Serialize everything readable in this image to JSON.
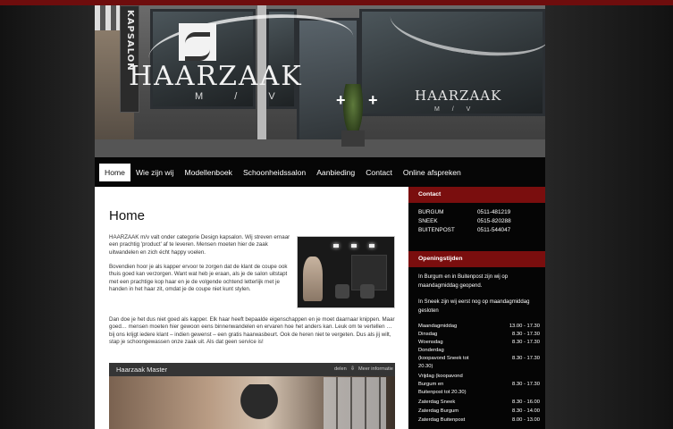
{
  "header": {
    "sign_text": "KAPSALON",
    "brand": "HAARZAAK",
    "brand_sub": "M / V",
    "window_brand": "HAARZAAK",
    "window_sub": "M / V"
  },
  "nav": {
    "items": [
      {
        "label": "Home",
        "active": true
      },
      {
        "label": "Wie zijn wij"
      },
      {
        "label": "Modellenboek"
      },
      {
        "label": "Schoonheidssalon"
      },
      {
        "label": "Aanbieding"
      },
      {
        "label": "Contact"
      },
      {
        "label": "Online afspreken"
      }
    ]
  },
  "main": {
    "title": "Home",
    "para1": "HAARZAAK m/v valt onder categorie Design kapsalon. Wij streven ernaar een prachtig 'product' af te leveren. Mensen moeten hier de zaak uitwandelen en zich écht happy voelen.",
    "para2": "Bovendien hoor je als kapper ervoor te zorgen dat de klant de coupe ook thuis goed kan verzorgen. Want wat heb je eraan, als je de salon uitstapt met een prachtige kop haar en je de volgende ochtend letterlijk met je handen in het haar zit, omdat je de coupe niet kunt stylen.",
    "para3": "Dan doe je het dus niet goed als kapper. Elk haar heeft bepaalde eigenschappen en je moet daarnaar knippen. Maar goed… mensen moeten hier gewoon eens binnenwandelen en ervaren hoe het anders kan. Leuk om te vertellen … bij ons krijgt iedere klant – indien gewenst – een gratis haarwasbeurt. Ook de heren niet te vergeten. Dus als jij wilt, stap je schoongewassen onze zaak uit. Als dat geen service is!",
    "video": {
      "title": "Haarzaak Master",
      "share_label": "delen",
      "info_label": "Meer informatie"
    }
  },
  "sidebar": {
    "contact_heading": "Contact",
    "contacts": [
      {
        "city": "BURGUM",
        "phone": "0511-481219"
      },
      {
        "city": "SNEEK",
        "phone": "0515-820288"
      },
      {
        "city": "BUITENPOST",
        "phone": "0511-544047"
      }
    ],
    "hours_heading": "Openingstijden",
    "note1": "In Burgum en in Buitenpost zijn wij op maandagmiddag geopend.",
    "note2": "In Sneek zijn wij eerst nog op maandagmiddag gesloten",
    "hours": [
      {
        "day": "Maandagmiddag",
        "time": "13.00 - 17.30"
      },
      {
        "day": "Dinsdag",
        "time": "8.30 - 17.30"
      },
      {
        "day": "Woensdag",
        "time": "8.30 - 17.30"
      },
      {
        "day": "Donderdag",
        "time": ""
      },
      {
        "day": "(koopavond Sneek tot",
        "time": "8.30 - 17.30"
      },
      {
        "day": "20.30)",
        "time": ""
      },
      {
        "day": "Vrijdag (koopavond",
        "time": ""
      },
      {
        "day": "Burgum en",
        "time": "8.30 - 17.30"
      },
      {
        "day": "Buitenpost tot 20.30)",
        "time": ""
      },
      {
        "day": "Zaterdag Sneek",
        "time": "8.30 - 16.00"
      },
      {
        "day": "Zaterdag Burgum",
        "time": "8.30 - 14.00"
      },
      {
        "day": "Zaterdag Buitenpost",
        "time": "8.00 - 13.00"
      }
    ]
  }
}
